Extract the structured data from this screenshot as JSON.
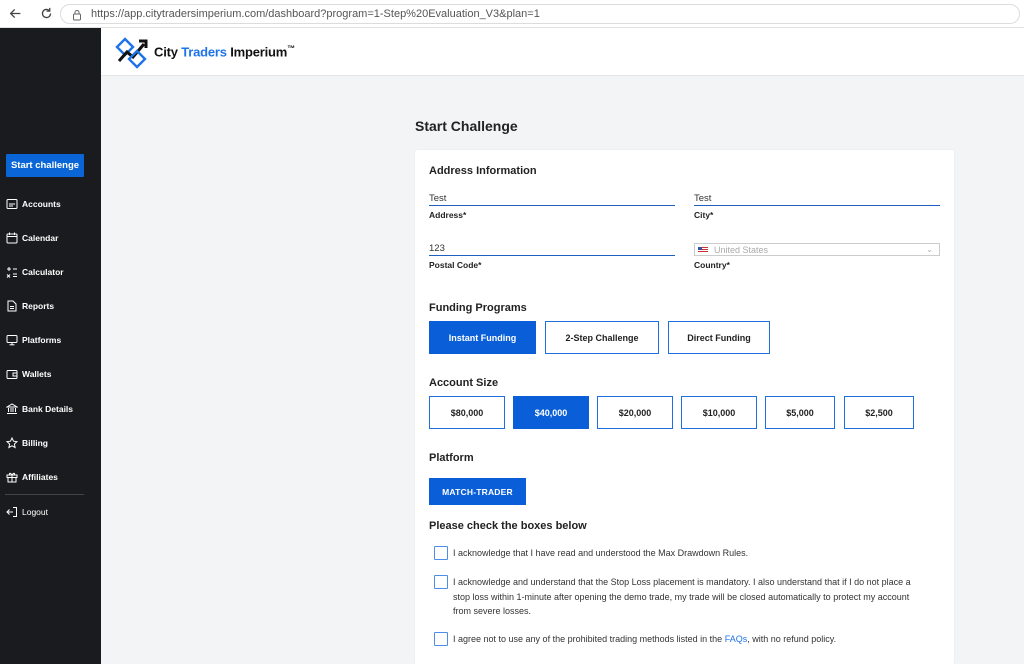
{
  "browser": {
    "url": "https://app.citytradersimperium.com/dashboard?program=1-Step%20Evaluation_V3&plan=1"
  },
  "brand": {
    "name_part1": "City",
    "name_part2": "Traders",
    "name_part3": "Imperium",
    "trademark": "™",
    "accent_color": "#1e73e8"
  },
  "sidebar": {
    "start_button": "Start challenge",
    "items": [
      {
        "label": "Accounts",
        "icon": "accounts-icon"
      },
      {
        "label": "Calendar",
        "icon": "calendar-icon"
      },
      {
        "label": "Calculator",
        "icon": "calculator-icon"
      },
      {
        "label": "Reports",
        "icon": "reports-icon"
      },
      {
        "label": "Platforms",
        "icon": "platforms-icon"
      },
      {
        "label": "Wallets",
        "icon": "wallet-icon"
      },
      {
        "label": "Bank Details",
        "icon": "bank-icon"
      },
      {
        "label": "Billing",
        "icon": "star-icon"
      },
      {
        "label": "Affiliates",
        "icon": "gift-icon"
      },
      {
        "label": "Logout",
        "icon": "logout-icon"
      }
    ]
  },
  "page": {
    "title": "Start Challenge"
  },
  "address": {
    "section_title": "Address Information",
    "address_value": "Test",
    "address_label": "Address*",
    "city_value": "Test",
    "city_label": "City*",
    "postal_value": "123",
    "postal_label": "Postal Code*",
    "country_value": "United States",
    "country_label": "Country*"
  },
  "funding": {
    "section_title": "Funding Programs",
    "options": [
      "Instant Funding",
      "2-Step Challenge",
      "Direct Funding"
    ],
    "selected": "Instant Funding"
  },
  "account_size": {
    "section_title": "Account Size",
    "options": [
      "$80,000",
      "$40,000",
      "$20,000",
      "$10,000",
      "$5,000",
      "$2,500"
    ],
    "selected": "$40,000"
  },
  "platform": {
    "section_title": "Platform",
    "button": "MATCH-TRADER"
  },
  "checks": {
    "section_title": "Please check the boxes below",
    "items": [
      {
        "text": "I acknowledge that I have read and understood the Max Drawdown Rules.",
        "checked": false
      },
      {
        "text": "I acknowledge and understand that the Stop Loss placement is mandatory. I also understand that if I do not place a stop loss within 1-minute after opening the demo trade, my trade will be closed automatically to protect my account from severe losses.",
        "checked": false
      },
      {
        "text_before": "I agree not to use any of the prohibited trading methods listed in the ",
        "link": "FAQs",
        "text_after": ", with no refund policy.",
        "checked": false
      }
    ]
  }
}
